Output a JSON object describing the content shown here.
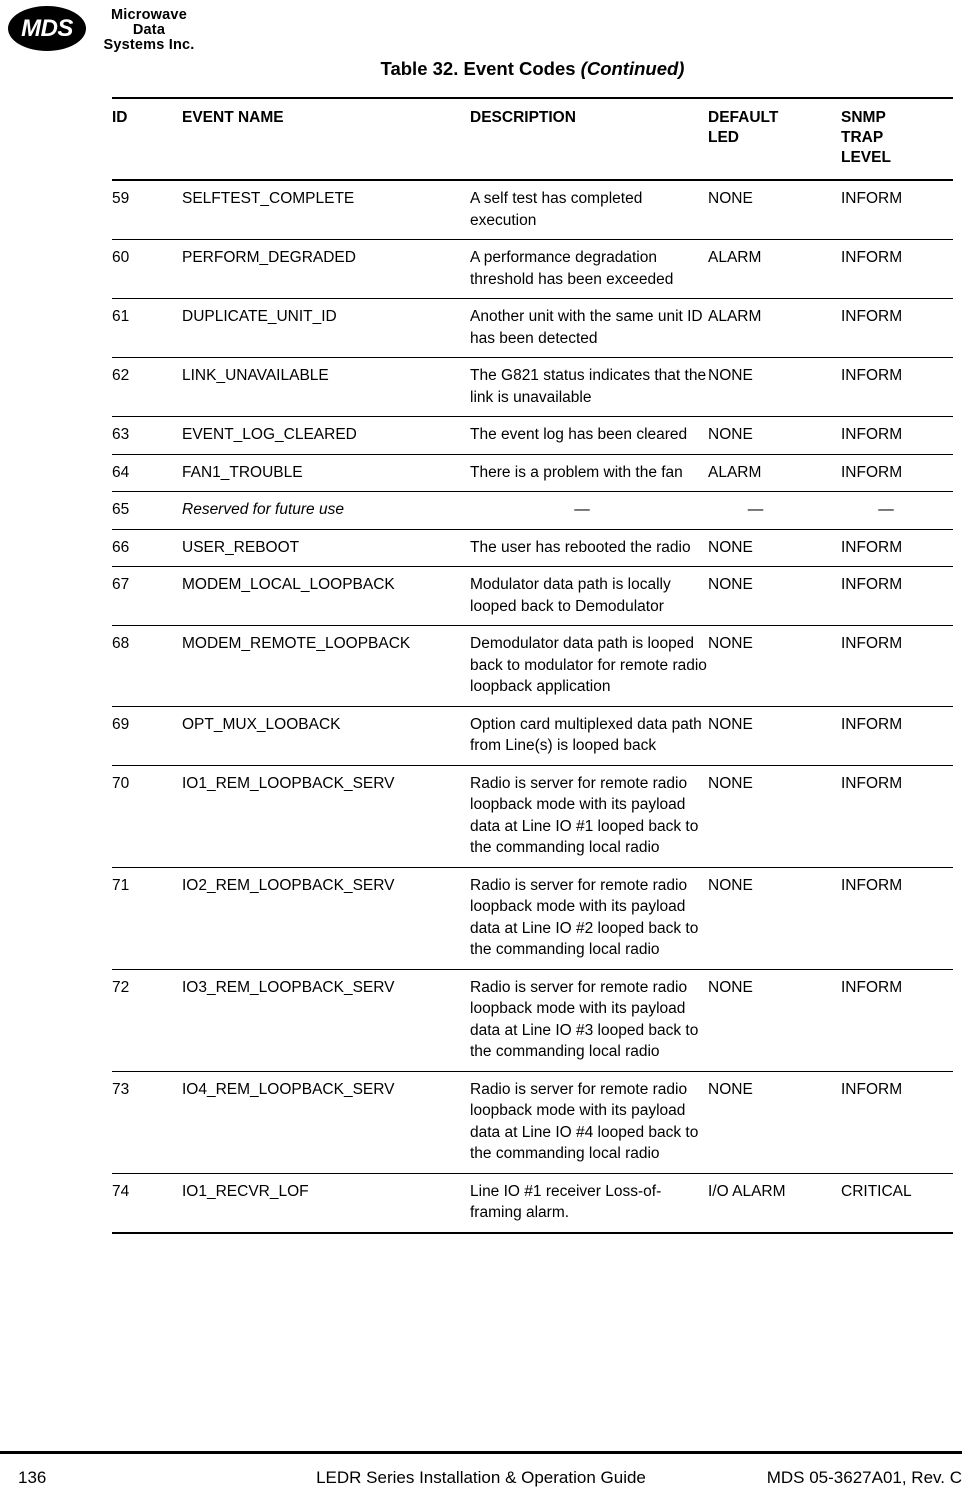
{
  "logo": {
    "mark_text": "MDS",
    "line1": "Microwave",
    "line2": "Data",
    "line3": "Systems Inc."
  },
  "title": {
    "main": "Table 32. Event Codes ",
    "continued": "(Continued)"
  },
  "table": {
    "columns": [
      {
        "key": "id",
        "label": "ID"
      },
      {
        "key": "name",
        "label": "EVENT NAME"
      },
      {
        "key": "desc",
        "label": "DESCRIPTION"
      },
      {
        "key": "led",
        "label": "DEFAULT\nLED"
      },
      {
        "key": "snmp",
        "label": "SNMP\nTRAP\nLEVEL"
      }
    ],
    "column_labels": {
      "id": "ID",
      "name": "EVENT NAME",
      "desc": "DESCRIPTION",
      "led_line1": "DEFAULT",
      "led_line2": "LED",
      "snmp_line1": "SNMP",
      "snmp_line2": "TRAP",
      "snmp_line3": "LEVEL"
    },
    "rows": [
      {
        "id": "59",
        "name": "SELFTEST_COMPLETE",
        "desc": "A self test has completed execution",
        "led": "NONE",
        "snmp": "INFORM",
        "reserved": false
      },
      {
        "id": "60",
        "name": "PERFORM_DEGRADED",
        "desc": "A performance degradation threshold has been exceeded",
        "led": "ALARM",
        "snmp": "INFORM",
        "reserved": false
      },
      {
        "id": "61",
        "name": "DUPLICATE_UNIT_ID",
        "desc": "Another unit with the same unit ID has been detected",
        "led": "ALARM",
        "snmp": "INFORM",
        "reserved": false
      },
      {
        "id": "62",
        "name": "LINK_UNAVAILABLE",
        "desc": "The G821 status indicates that the link is unavailable",
        "led": "NONE",
        "snmp": "INFORM",
        "reserved": false
      },
      {
        "id": "63",
        "name": "EVENT_LOG_CLEARED",
        "desc": "The event log has been cleared",
        "led": "NONE",
        "snmp": "INFORM",
        "reserved": false
      },
      {
        "id": "64",
        "name": "FAN1_TROUBLE",
        "desc": "There is a problem with the fan",
        "led": "ALARM",
        "snmp": "INFORM",
        "reserved": false
      },
      {
        "id": "65",
        "name": "Reserved for future use",
        "desc": "—",
        "led": "—",
        "snmp": "—",
        "reserved": true
      },
      {
        "id": "66",
        "name": "USER_REBOOT",
        "desc": "The user has rebooted the radio",
        "led": "NONE",
        "snmp": "INFORM",
        "reserved": false
      },
      {
        "id": "67",
        "name": "MODEM_LOCAL_LOOPBACK",
        "desc": "Modulator data path is locally looped back to Demodulator",
        "led": "NONE",
        "snmp": "INFORM",
        "reserved": false
      },
      {
        "id": "68",
        "name": "MODEM_REMOTE_LOOPBACK",
        "desc": "Demodulator data path is looped back to modulator for remote radio loopback application",
        "led": "NONE",
        "snmp": "INFORM",
        "reserved": false
      },
      {
        "id": "69",
        "name": "OPT_MUX_LOOBACK",
        "desc": "Option card multiplexed data path from Line(s) is looped back",
        "led": "NONE",
        "snmp": "INFORM",
        "reserved": false
      },
      {
        "id": "70",
        "name": "IO1_REM_LOOPBACK_SERV",
        "desc": "Radio is server for remote radio loopback mode with its payload data at Line IO #1 looped back to the commanding local radio",
        "led": "NONE",
        "snmp": "INFORM",
        "reserved": false
      },
      {
        "id": "71",
        "name": "IO2_REM_LOOPBACK_SERV",
        "desc": "Radio is server for remote radio loopback mode with its payload data at Line IO #2 looped back to the commanding local radio",
        "led": "NONE",
        "snmp": "INFORM",
        "reserved": false
      },
      {
        "id": "72",
        "name": "IO3_REM_LOOPBACK_SERV",
        "desc": "Radio is server for remote radio loopback mode with its payload data at Line IO #3 looped back to the commanding local radio",
        "led": "NONE",
        "snmp": "INFORM",
        "reserved": false
      },
      {
        "id": "73",
        "name": "IO4_REM_LOOPBACK_SERV",
        "desc": "Radio is server for remote radio loopback mode with its payload data at Line IO #4 looped back to the commanding local radio",
        "led": "NONE",
        "snmp": "INFORM",
        "reserved": false
      },
      {
        "id": "74",
        "name": "IO1_RECVR_LOF",
        "desc": "Line IO #1 receiver Loss-of-framing alarm.",
        "led": "I/O ALARM",
        "snmp": "CRITICAL",
        "reserved": false
      }
    ]
  },
  "footer": {
    "page_number": "136",
    "center": "LEDR Series Installation & Operation Guide",
    "right": "MDS 05-3627A01, Rev. C"
  },
  "colors": {
    "text": "#000000",
    "background": "#ffffff",
    "rule": "#000000"
  }
}
